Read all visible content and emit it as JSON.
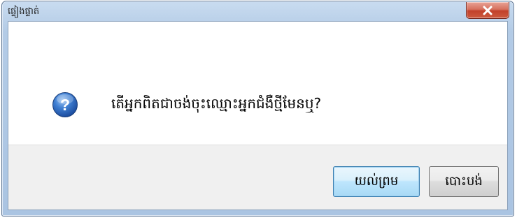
{
  "window": {
    "title": "ផ្ទៀងផ្ទាត់",
    "close_symbol": "✕"
  },
  "dialog": {
    "icon": "question-icon",
    "message": "តើអ្នកពិតជាចង់ចុះឈ្មោះអ្នកជំងឺថ្មីមែនឬ?"
  },
  "buttons": {
    "ok_label": "យល់ព្រម",
    "cancel_label": "បោះបង់"
  },
  "colors": {
    "titlebar": "#b3cbe6",
    "close_button": "#c2412b",
    "question_icon": "#2a63b8",
    "default_button_border": "#3c7fb1"
  }
}
